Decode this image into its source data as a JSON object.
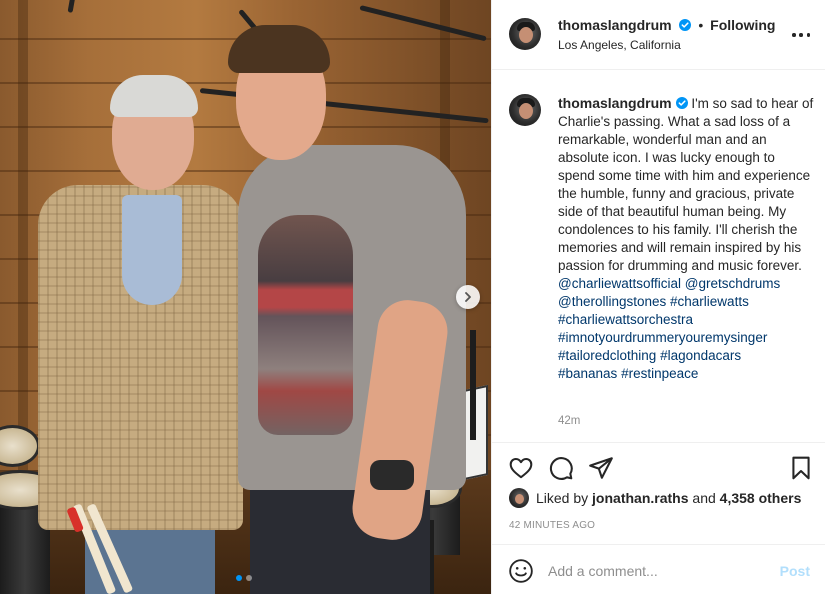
{
  "post": {
    "username": "thomaslangdrum",
    "follow_status": "Following",
    "separator": "•",
    "location": "Los Angeles, California",
    "verified_icon": "verified-badge-icon",
    "accent": "#0095f6"
  },
  "photo": {
    "carousel_count": 2,
    "active_index": 0
  },
  "caption": {
    "username": "thomaslangdrum",
    "text": "I'm so sad to hear of Charlie's passing. What a sad loss of a remarkable, wonderful man and an absolute icon. I was lucky enough to spend some time with him and experience the humble, funny and gracious, private side of that beautiful human being. My condolences to his family. I'll cherish the memories and will remain inspired by his passion for drumming and music forever.",
    "tags": [
      "@charliewattsofficial",
      "@gretschdrums",
      "@therollingstones",
      "#charliewatts",
      "#charliewattsorchestra",
      "#imnotyourdrummeryouremysinger",
      "#tailoredclothing",
      "#lagondacars",
      "#bananas",
      "#restinpeace"
    ],
    "time": "42m"
  },
  "likes": {
    "prefix": "Liked by",
    "user": "jonathan.raths",
    "joiner": "and",
    "others": "4,358 others"
  },
  "timestamp": "42 MINUTES AGO",
  "comment": {
    "placeholder": "Add a comment...",
    "post_label": "Post"
  },
  "colors": {
    "link": "#00376b",
    "muted": "#8e8e8e",
    "post_disabled": "#b2dffc"
  }
}
